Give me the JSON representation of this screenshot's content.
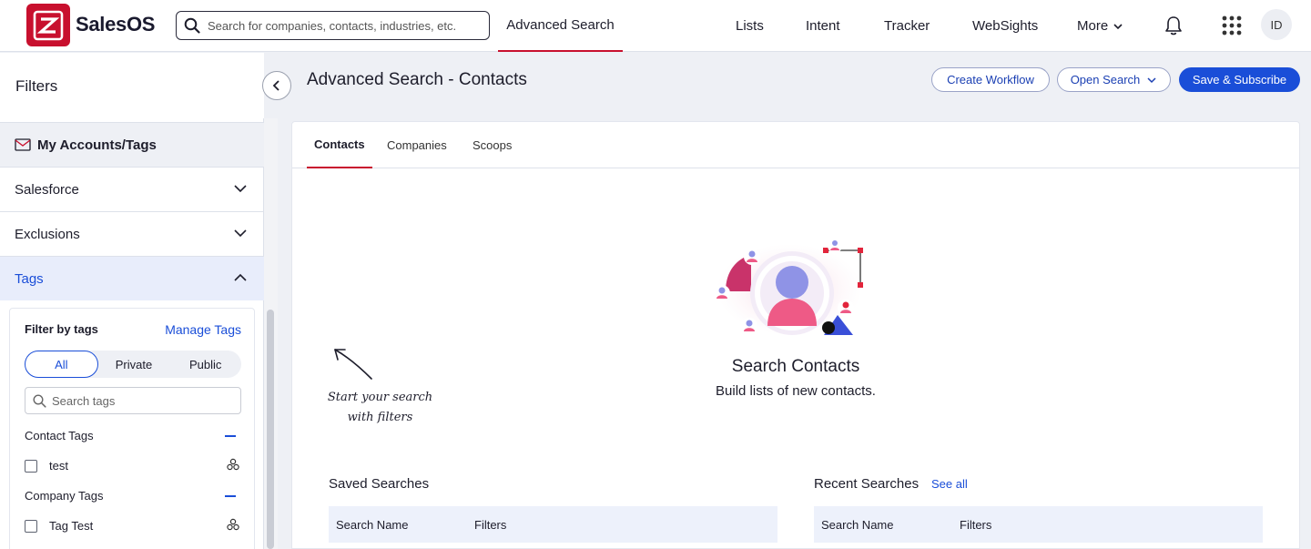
{
  "app": {
    "brand": "SalesOS",
    "avatar_initials": "ID"
  },
  "search": {
    "placeholder": "Search for companies, contacts, industries, etc."
  },
  "nav": {
    "advanced_search": "Advanced Search",
    "items": [
      "Lists",
      "Intent",
      "Tracker",
      "WebSights"
    ],
    "more": "More"
  },
  "sidebar": {
    "title": "Filters",
    "my_accounts": "My Accounts/Tags",
    "sections": [
      "Salesforce",
      "Exclusions"
    ],
    "tags_section": "Tags",
    "filter_by_tags": "Filter by tags",
    "manage_tags": "Manage Tags",
    "segments": [
      "All",
      "Private",
      "Public"
    ],
    "selected_segment": "All",
    "tag_search_placeholder": "Search tags",
    "contact_tags_label": "Contact Tags",
    "contact_tags": [
      "test"
    ],
    "company_tags_label": "Company Tags",
    "company_tags": [
      "Tag Test"
    ]
  },
  "main": {
    "title": "Advanced Search - Contacts",
    "create_workflow": "Create Workflow",
    "open_search": "Open Search",
    "save_subscribe": "Save & Subscribe",
    "tabs": [
      "Contacts",
      "Companies",
      "Scoops"
    ],
    "active_tab": "Contacts",
    "hint_line1": "Start your search",
    "hint_line2": "with filters",
    "empty_title": "Search Contacts",
    "empty_subtitle": "Build lists of new contacts.",
    "saved_searches": {
      "title": "Saved Searches",
      "columns": [
        "Search Name",
        "Filters"
      ]
    },
    "recent_searches": {
      "title": "Recent Searches",
      "see_all": "See all",
      "columns": [
        "Search Name",
        "Filters"
      ]
    }
  },
  "colors": {
    "brand_red": "#c8102e",
    "primary_blue": "#1a4ed8",
    "table_header": "#edf1fb"
  }
}
